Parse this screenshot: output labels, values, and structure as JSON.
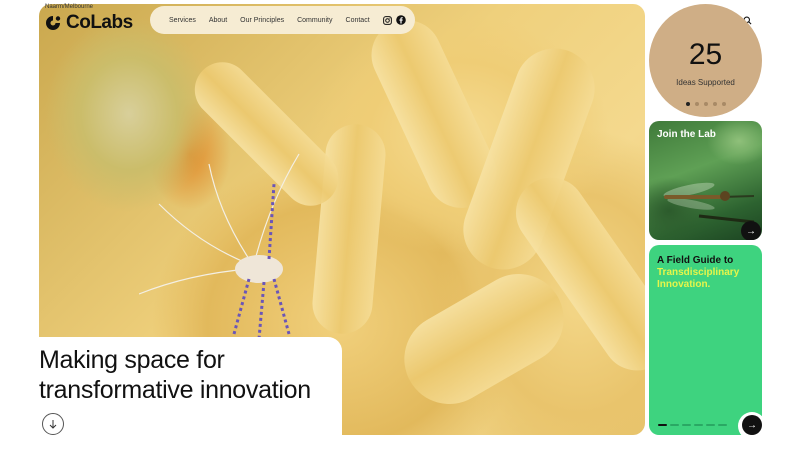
{
  "brand": {
    "location": "Naarm/Melbourne",
    "name": "CoLabs"
  },
  "nav": {
    "items": [
      "Services",
      "About",
      "Our Principles",
      "Community",
      "Contact"
    ],
    "social": [
      "instagram-icon",
      "facebook-icon"
    ]
  },
  "hero": {
    "headline_line1": "Making space for",
    "headline_line2": "transformative innovation"
  },
  "stat": {
    "value": "25",
    "label": "Ideas Supported",
    "dots": 5,
    "active_dot": 0
  },
  "cards": {
    "join_title": "Join the Lab",
    "guide_title_part1": "A Field Guide to",
    "guide_title_part2": "Transdisciplinary Innovation.",
    "guide_progress_count": 6,
    "guide_progress_active": 0
  },
  "colors": {
    "nav_bg": "#f6ecd3",
    "stat_bg": "#cfae86",
    "guide_bg": "#3ed37f",
    "guide_highlight": "#e6f54a"
  }
}
